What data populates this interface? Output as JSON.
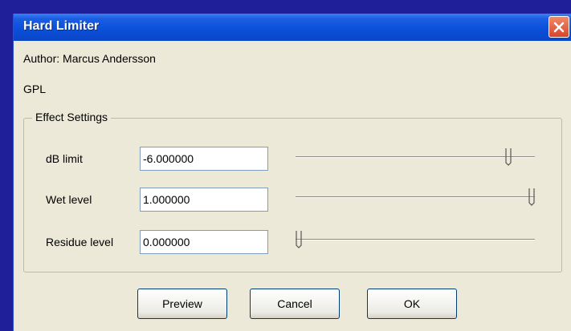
{
  "window": {
    "title": "Hard Limiter"
  },
  "author": "Author: Marcus Andersson",
  "license": "GPL",
  "settings": {
    "group_label": "Effect Settings",
    "params": [
      {
        "label": "dB limit",
        "value": "-6.000000",
        "slider_fraction": 0.9
      },
      {
        "label": "Wet level",
        "value": "1.000000",
        "slider_fraction": 1.0
      },
      {
        "label": "Residue level",
        "value": "0.000000",
        "slider_fraction": 0.0
      }
    ]
  },
  "buttons": {
    "preview": "Preview",
    "cancel": "Cancel",
    "ok": "OK"
  },
  "colors": {
    "background": "#1f1f9a",
    "titlebar": "#0a4fd8",
    "dialog": "#ece9d8"
  }
}
